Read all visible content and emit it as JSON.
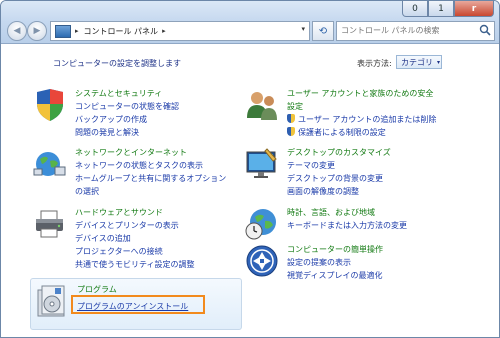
{
  "window": {
    "title_buttons": [
      "0",
      "1",
      "r"
    ]
  },
  "addressbar": {
    "crumb": "コントロール パネル",
    "separator": "▸",
    "separator_after": "▸",
    "dropdown": "▾"
  },
  "search": {
    "placeholder": "コントロール パネルの検索"
  },
  "header": {
    "title": "コンピューターの設定を調整します",
    "viewby_label": "表示方法:",
    "viewby_value": "カテゴリ",
    "viewby_arrow": "▾"
  },
  "categories": [
    {
      "title": "システムとセキュリティ",
      "links": [
        "コンピューターの状態を確認",
        "バックアップの作成",
        "問題の発見と解決"
      ]
    },
    {
      "title": "ネットワークとインターネット",
      "links": [
        "ネットワークの状態とタスクの表示",
        "ホームグループと共有に関するオプション",
        "の選択"
      ]
    },
    {
      "title": "ハードウェアとサウンド",
      "links": [
        "デバイスとプリンターの表示",
        "デバイスの追加",
        "プロジェクターへの接続",
        "共通で使うモビリティ設定の調整"
      ]
    },
    {
      "title_lines": [
        "ユーザー アカウントと家族のための安全",
        "設定"
      ],
      "links": [
        "ユーザー アカウントの追加または削除",
        "保護者による制限の設定"
      ]
    },
    {
      "title": "デスクトップのカスタマイズ",
      "links": [
        "テーマの変更",
        "デスクトップの背景の変更",
        "画面の解像度の調整"
      ]
    },
    {
      "title": "時計、言語、および地域",
      "links": [
        "キーボードまたは入力方法の変更"
      ]
    },
    {
      "title": "コンピューターの簡単操作",
      "links": [
        "設定の提案の表示",
        "視覚ディスプレイの最適化"
      ]
    }
  ],
  "programs": {
    "title": "プログラム",
    "link": "プログラムのアンインストール"
  },
  "colors": {
    "category_title": "#127a12",
    "link": "#1a3aa8",
    "highlight": "#f28a1d"
  }
}
